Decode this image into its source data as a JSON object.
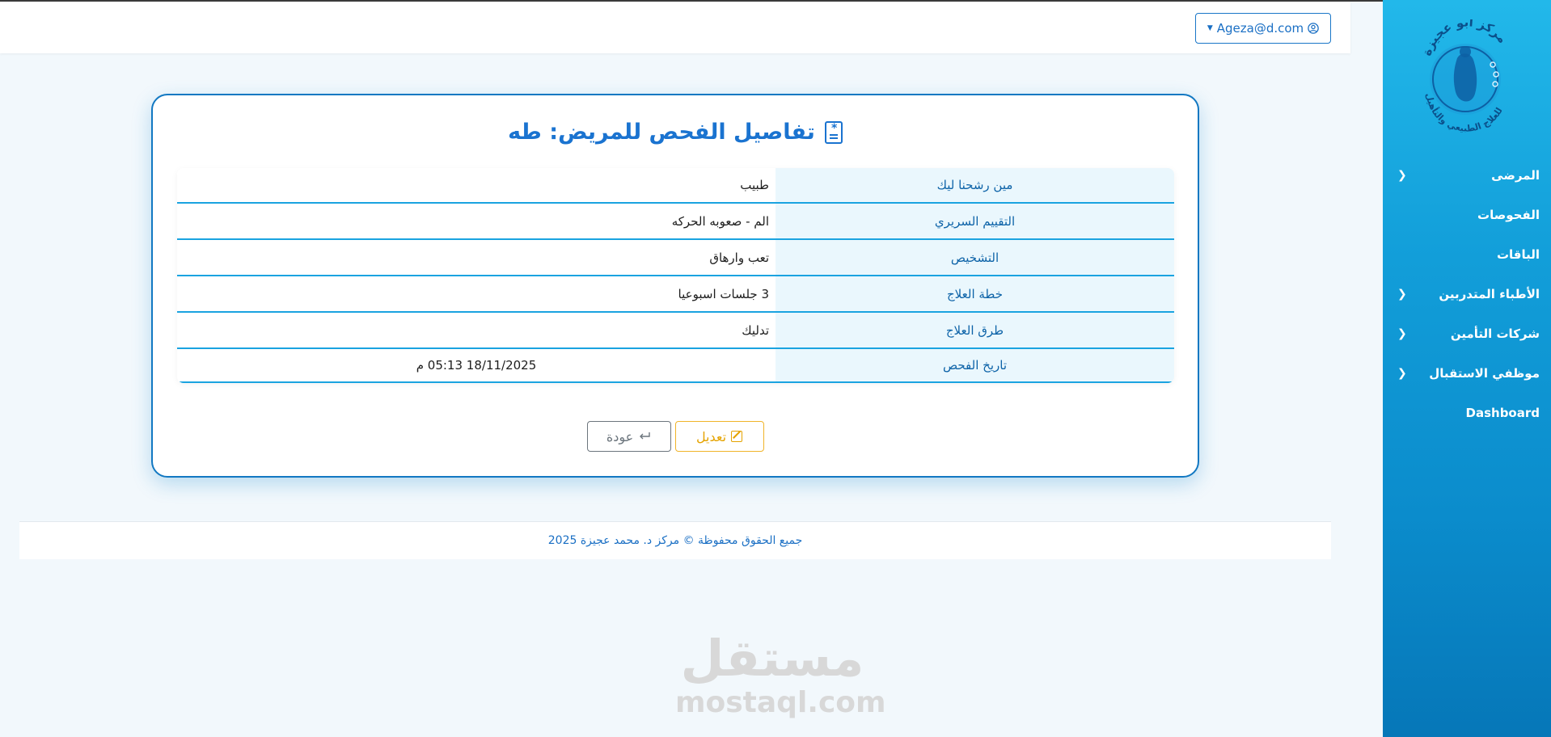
{
  "sidebar": {
    "logo_text_top": "مركز أبو عجيزة",
    "logo_text_bottom": "للعلاج الطبيعي والتأهيل",
    "items": [
      {
        "label": "المرضى",
        "chevron": true
      },
      {
        "label": "الفحوصات",
        "chevron": false
      },
      {
        "label": "الباقات",
        "chevron": false
      },
      {
        "label": "الأطباء المتدربين",
        "chevron": true
      },
      {
        "label": "شركات التأمين",
        "chevron": true
      },
      {
        "label": "موظفي الاستقبال",
        "chevron": true
      },
      {
        "label": "Dashboard",
        "chevron": false
      }
    ]
  },
  "header": {
    "user_email": "Ageza@d.com",
    "user_icon": "user-circle-icon"
  },
  "card": {
    "title": "تفاصيل الفحص للمريض: طه",
    "title_icon": "file-medical-icon",
    "rows": [
      {
        "label": "مين رشحنا ليك",
        "value": "طبيب"
      },
      {
        "label": "التقييم السريري",
        "value": "الم - صعوبه الحركه"
      },
      {
        "label": "التشخيص",
        "value": "تعب وارهاق"
      },
      {
        "label": "خطة العلاج",
        "value": "3 جلسات اسبوعيا"
      },
      {
        "label": "طرق العلاج",
        "value": "تدليك"
      },
      {
        "label": "تاريخ الفحص",
        "value": "18/11/2025 05:13 م"
      }
    ],
    "edit_label": "تعديل",
    "back_label": "عودة"
  },
  "footer": {
    "text": "جميع الحقوق محفوظة © مركز د. محمد عجيزة 2025"
  },
  "watermark": {
    "ar": "مستقل",
    "en": "mostaql.com"
  },
  "colors": {
    "primary": "#1a73d0",
    "sidebar_top": "#22b8ea",
    "sidebar_bottom": "#0677b8",
    "edit": "#e5a300",
    "back": "#6c757d"
  }
}
